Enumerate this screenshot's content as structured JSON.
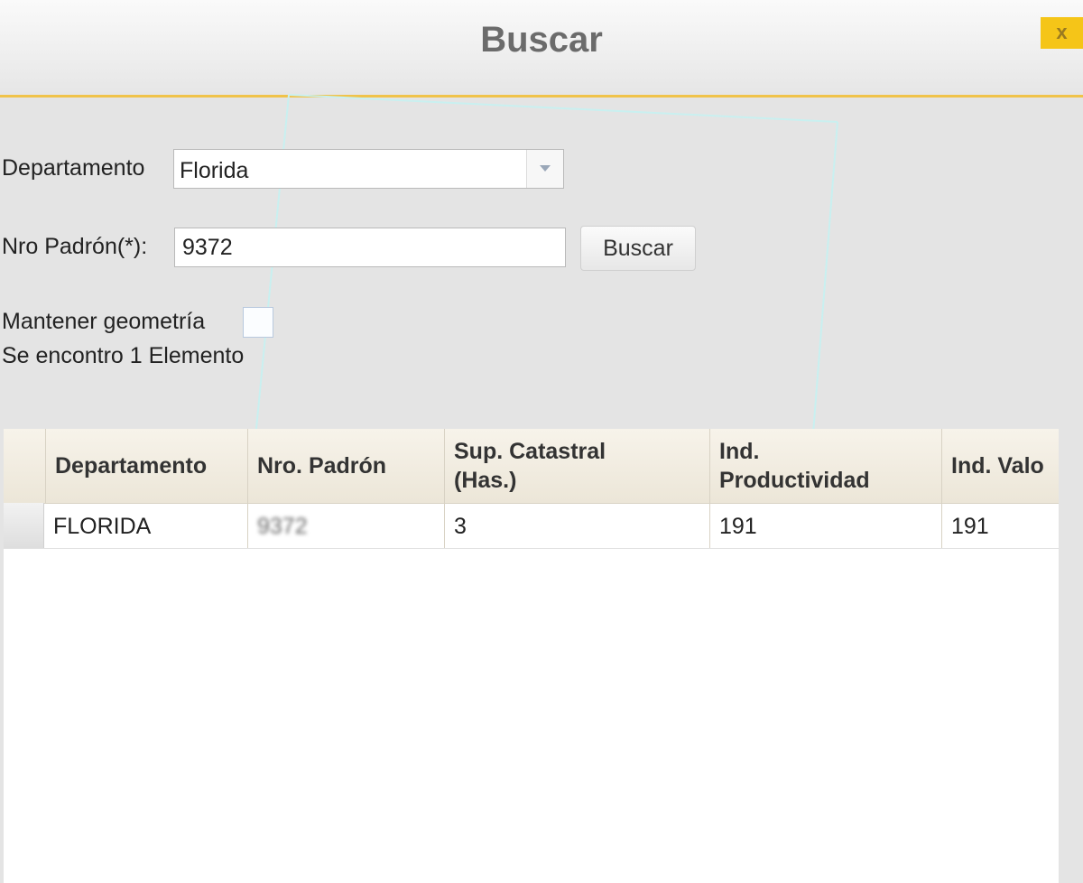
{
  "dialog": {
    "title": "Buscar",
    "close_label": "x"
  },
  "form": {
    "departamento_label": "Departamento",
    "departamento_value": "Florida",
    "padron_label": "Nro Padrón(*):",
    "padron_value": "9372",
    "search_button": "Buscar",
    "keep_geometry_label": "Mantener geometría",
    "result_text": "Se encontro 1 Elemento"
  },
  "table": {
    "columns": [
      "Departamento",
      "Nro. Padrón",
      "Sup. Catastral\n(Has.)",
      "Ind.\nProductividad",
      "Ind. Valo"
    ],
    "rows": [
      [
        "FLORIDA",
        "9372",
        "3",
        "191",
        "191"
      ]
    ]
  },
  "colors": {
    "accent": "#f0c34a",
    "close_button": "#f5c518"
  }
}
